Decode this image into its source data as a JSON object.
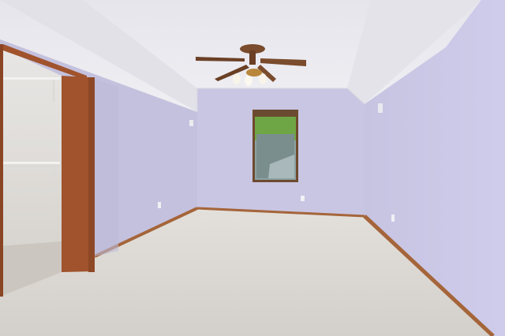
{
  "scene": {
    "kind": "photo",
    "subject": "empty-bedroom-with-vaulted-ceiling",
    "colors": {
      "wall": "#c9c6e3",
      "wall_shadow": "#b9b6d4",
      "ceiling": "#e9e8ee",
      "carpet": "#d9d6d2",
      "trim": "#a5653a",
      "door_frame": "#a0532c",
      "window_glass": "#6f8a86",
      "foliage": "#6fa645"
    },
    "icons": [
      "ceiling-fan-icon",
      "window-icon",
      "outlet-icon",
      "air-vent-icon"
    ]
  }
}
